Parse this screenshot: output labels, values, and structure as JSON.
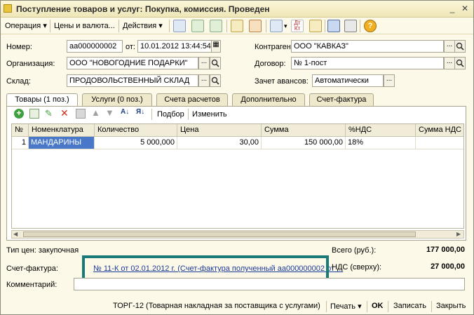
{
  "window": {
    "title": "Поступление товаров и услуг: Покупка, комиссия. Проведен"
  },
  "toolbar": {
    "operation": "Операция",
    "prices": "Цены и валюта...",
    "actions": "Действия"
  },
  "header": {
    "number_label": "Номер:",
    "number_value": "аа000000002",
    "date_label": "от:",
    "date_value": "10.01.2012 13:44:54",
    "org_label": "Организация:",
    "org_value": "ООО \"НОВОГОДНИЕ ПОДАРКИ\"",
    "warehouse_label": "Склад:",
    "warehouse_value": "ПРОДОВОЛЬСТВЕННЫЙ СКЛАД",
    "contractor_label": "Контрагент:",
    "contractor_value": "ООО \"КАВКАЗ\"",
    "contract_label": "Договор:",
    "contract_value": "№ 1-пост",
    "advance_label": "Зачет авансов:",
    "advance_value": "Автоматически"
  },
  "tabs": [
    {
      "label": "Товары (1 поз.)"
    },
    {
      "label": "Услуги (0 поз.)"
    },
    {
      "label": "Счета расчетов"
    },
    {
      "label": "Дополнительно"
    },
    {
      "label": "Счет-фактура"
    }
  ],
  "subtoolbar": {
    "selection": "Подбор",
    "change": "Изменить"
  },
  "grid": {
    "columns": [
      "№",
      "Номенклатура",
      "Количество",
      "Цена",
      "Сумма",
      "%НДС",
      "Сумма НДС"
    ],
    "rows": [
      {
        "num": "1",
        "item": "МАНДАРИНЫ",
        "qty": "5 000,000",
        "price": "30,00",
        "sum": "150 000,00",
        "vat": "18%",
        "vat_sum": ""
      }
    ]
  },
  "footer": {
    "price_type": "Тип цен: закупочная",
    "invoice_label": "Счет-фактура:",
    "invoice_link": "№ 11-К от 02.01.2012 г. (Счет-фактура полученный аа000000002 от ...",
    "total_label": "Всего (руб.):",
    "total_value": "177 000,00",
    "vat_label": "НДС (сверху):",
    "vat_value": "27 000,00",
    "comment_label": "Комментарий:",
    "comment_value": ""
  },
  "bottom": {
    "torg": "ТОРГ-12 (Товарная накладная за поставщика с услугами)",
    "print": "Печать",
    "ok": "OK",
    "save": "Записать",
    "close": "Закрыть"
  }
}
